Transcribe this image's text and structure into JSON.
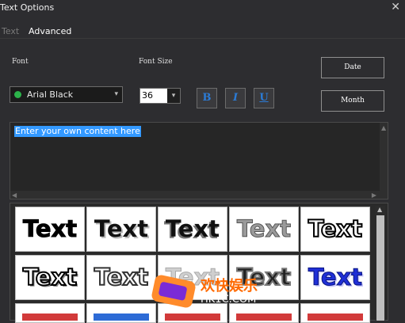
{
  "window": {
    "title": "Text Options",
    "close_glyph": "✕"
  },
  "tabs": [
    {
      "label": "Text"
    },
    {
      "label": "Advanced"
    }
  ],
  "labels": {
    "font": "Font",
    "font_size": "Font Size"
  },
  "font_select": {
    "value": "Arial Black",
    "caret": "▾"
  },
  "size_select": {
    "value": "36",
    "caret": "▾"
  },
  "format_buttons": [
    {
      "label": "B"
    },
    {
      "label": "I"
    },
    {
      "label": "U"
    }
  ],
  "right_buttons": {
    "date": "Date",
    "month": "Month"
  },
  "editor": {
    "text": "Enter your own content here"
  },
  "gallery": {
    "tiles": [
      {
        "text": "Text"
      },
      {
        "text": "Text"
      },
      {
        "text": "Text"
      },
      {
        "text": "Text"
      },
      {
        "text": "Text"
      },
      {
        "text": "Text"
      },
      {
        "text": "Text"
      },
      {
        "text": "Text"
      },
      {
        "text": "Text"
      },
      {
        "text": "Text"
      }
    ]
  },
  "watermark": {
    "cn": "欢快娱乐",
    "url": "HK1C.COM"
  }
}
